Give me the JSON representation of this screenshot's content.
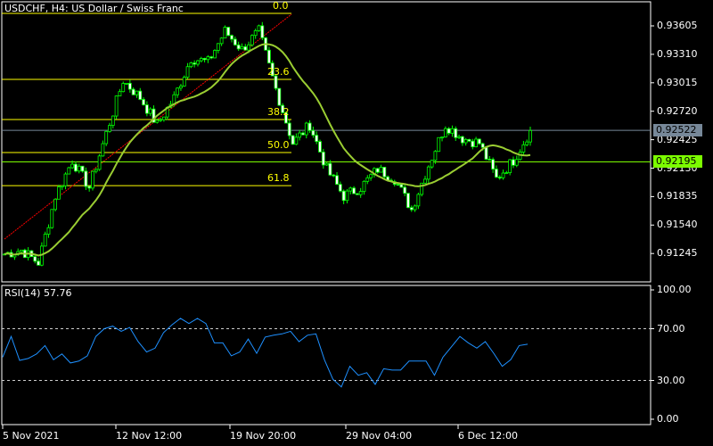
{
  "title": "USDCHF, H4:  US Dollar / Swiss Franc",
  "colors": {
    "background": "#000000",
    "candle": "#00ff00",
    "ma": "#9acd32",
    "fib": "#ffff00",
    "trend": "#ff0000",
    "bid_line": "#778899",
    "highlight": "#7cfc00",
    "rsi": "#1e90ff"
  },
  "price_axis": [
    "0.93605",
    "0.93310",
    "0.93015",
    "0.92720",
    "0.92425",
    "0.92130",
    "0.91835",
    "0.91540",
    "0.91245"
  ],
  "bid_price": "0.92522",
  "marker_price": "0.92195",
  "fibonacci": [
    {
      "label": "0.0",
      "price": 0.93734
    },
    {
      "label": "23.6",
      "price": 0.9305
    },
    {
      "label": "38.2",
      "price": 0.92634
    },
    {
      "label": "50.0",
      "price": 0.92292
    },
    {
      "label": "61.8",
      "price": 0.91949
    }
  ],
  "time_axis": [
    "5 Nov 2021",
    "12 Nov 12:00",
    "19 Nov 20:00",
    "29 Nov 04:00",
    "6 Dec 12:00"
  ],
  "rsi": {
    "label": "RSI(14) 57.76",
    "axis": [
      "100.00",
      "70.00",
      "30.00",
      "0.00"
    ],
    "levels": [
      70,
      30
    ],
    "values": [
      48,
      64,
      45.5,
      47,
      50.5,
      57,
      46,
      50.5,
      43.5,
      45,
      49,
      64,
      70,
      72,
      68,
      71,
      60,
      52,
      55,
      67,
      73,
      78,
      74,
      78,
      74,
      59,
      59,
      49,
      52,
      62,
      51,
      63.5,
      65,
      66,
      68,
      60,
      65,
      66,
      46,
      31,
      25,
      41,
      34,
      36,
      27,
      39,
      38,
      38,
      45,
      45,
      45,
      34,
      48,
      56,
      64,
      59,
      55,
      60,
      51,
      41,
      46,
      57,
      58
    ]
  },
  "chart_data": {
    "type": "candlestick",
    "symbol": "USDCHF",
    "timeframe": "H4",
    "closes": [
      0.9124,
      0.9128,
      0.9115,
      0.9184,
      0.9221,
      0.9193,
      0.9249,
      0.9304,
      0.9286,
      0.9258,
      0.9286,
      0.9327,
      0.9323,
      0.9355,
      0.9336,
      0.9355,
      0.9295,
      0.9239,
      0.9258,
      0.9212,
      0.9184,
      0.9193,
      0.9212,
      0.9202,
      0.917,
      0.9216,
      0.9258,
      0.9244,
      0.9239,
      0.9202,
      0.9221,
      0.9252
    ],
    "ylim": [
      0.911,
      0.9375
    ]
  }
}
